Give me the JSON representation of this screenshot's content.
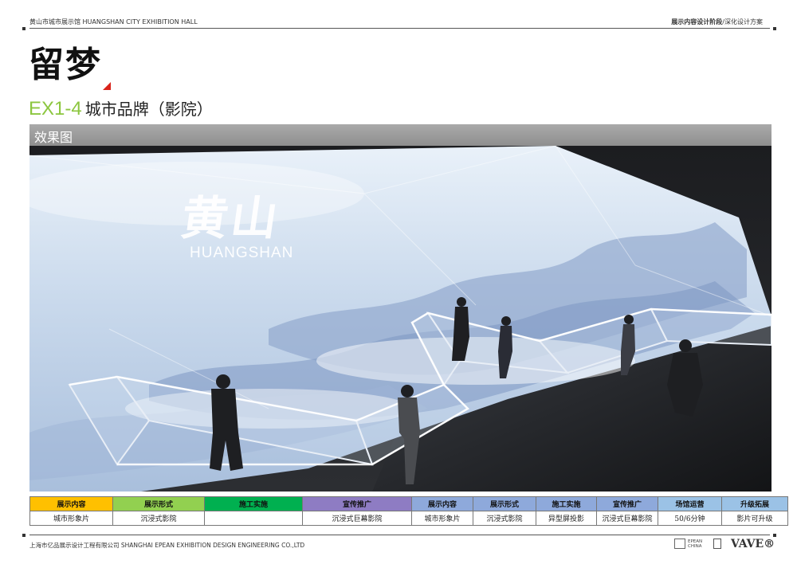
{
  "header": {
    "left_text": "黄山市城市展示馆 HUANGSHAN CITY EXHIBITION HALL",
    "right_bold": "展示内容设计阶段",
    "right_rest": "/深化设计方案"
  },
  "title": {
    "main": "留梦",
    "code": "EX1-4",
    "name": "城市品牌（影院）"
  },
  "section": {
    "label": "效果图"
  },
  "render": {
    "screen_title_cn": "黄山",
    "screen_title_en": "HUANGSHAN"
  },
  "table": {
    "headers": [
      {
        "label": "展示内容",
        "color": "#ffc000"
      },
      {
        "label": "展示形式",
        "color": "#92d050"
      },
      {
        "label": "施工实施",
        "color": "#00b050"
      },
      {
        "label": "宣传推广",
        "color": "#8e7cc3"
      },
      {
        "label": "展示内容",
        "color": "#8ea9db"
      },
      {
        "label": "展示形式",
        "color": "#8ea9db"
      },
      {
        "label": "施工实施",
        "color": "#8ea9db"
      },
      {
        "label": "宣传推广",
        "color": "#8ea9db"
      },
      {
        "label": "场馆运营",
        "color": "#9bc2e6"
      },
      {
        "label": "升级拓展",
        "color": "#9bc2e6"
      }
    ],
    "row": [
      "城市形象片",
      "沉浸式影院",
      "",
      "沉浸式巨幕影院",
      "城市形象片",
      "沉浸式影院",
      "异型屏投影",
      "沉浸式巨幕影院",
      "50/6分钟",
      "影片可升级"
    ]
  },
  "footer": {
    "company": "上海市亿品展示设计工程有限公司 SHANGHAI EPEAN EXHIBITION DESIGN ENGINEERING CO.,LTD",
    "logo_epean": "EPEAN CHINA",
    "logo_vave": "VAVE®"
  }
}
